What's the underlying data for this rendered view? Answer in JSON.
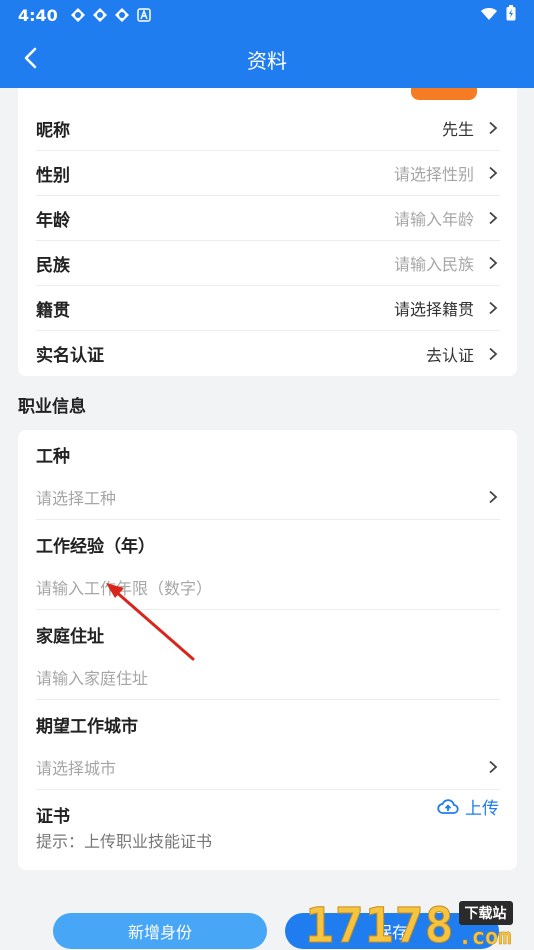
{
  "status_bar": {
    "time": "4:40",
    "icons": [
      "app-icon-1",
      "app-icon-2",
      "app-icon-3",
      "a-icon"
    ],
    "right_icons": [
      "wifi-icon",
      "battery-icon"
    ]
  },
  "header": {
    "title": "资料"
  },
  "basic_info": {
    "rows": [
      {
        "label": "昵称",
        "value": "先生",
        "placeholder": false
      },
      {
        "label": "性别",
        "value": "请选择性别",
        "placeholder": true
      },
      {
        "label": "年龄",
        "value": "请输入年龄",
        "placeholder": true
      },
      {
        "label": "民族",
        "value": "请输入民族",
        "placeholder": true
      },
      {
        "label": "籍贯",
        "value": "请选择籍贯",
        "placeholder": false
      },
      {
        "label": "实名认证",
        "value": "去认证",
        "placeholder": false
      }
    ]
  },
  "job_info": {
    "section_title": "职业信息",
    "items": [
      {
        "label": "工种",
        "placeholder": "请选择工种",
        "chevron": true
      },
      {
        "label": "工作经验（年）",
        "placeholder": "请输入工作年限（数字）",
        "chevron": false
      },
      {
        "label": "家庭住址",
        "placeholder": "请输入家庭住址",
        "chevron": false
      },
      {
        "label": "期望工作城市",
        "placeholder": "请选择城市",
        "chevron": true
      }
    ],
    "certificate": {
      "label": "证书",
      "upload_label": "上传",
      "hint": "提示：上传职业技能证书"
    }
  },
  "buttons": {
    "add_identity": "新增身份",
    "save": "保存"
  },
  "watermark": {
    "number": "17178",
    "badge": "下载站",
    "suffix": ".com"
  },
  "colors": {
    "primary": "#1f7df0",
    "secondary_button": "#47a6f6",
    "tag": "#f57c22",
    "arrow": "#d9261c"
  }
}
